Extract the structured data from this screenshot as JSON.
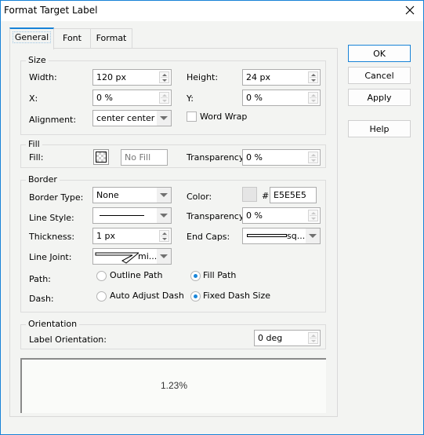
{
  "window": {
    "title": "Format Target Label"
  },
  "tabs": [
    {
      "label": "General",
      "active": true
    },
    {
      "label": "Font",
      "active": false
    },
    {
      "label": "Format",
      "active": false
    }
  ],
  "buttons": {
    "ok": "OK",
    "cancel": "Cancel",
    "apply": "Apply",
    "help": "Help"
  },
  "size": {
    "title": "Size",
    "width_label": "Width:",
    "width_value": "120 px",
    "height_label": "Height:",
    "height_value": "24 px",
    "x_label": "X:",
    "x_value": "0 %",
    "y_label": "Y:",
    "y_value": "0 %",
    "alignment_label": "Alignment:",
    "alignment_value": "center center",
    "word_wrap_label": "Word Wrap",
    "word_wrap_checked": false
  },
  "fill": {
    "title": "Fill",
    "fill_label": "Fill:",
    "fill_value": "No Fill",
    "transparency_label": "Transparency:",
    "transparency_value": "0 %"
  },
  "border": {
    "title": "Border",
    "border_type_label": "Border Type:",
    "border_type_value": "None",
    "color_label": "Color:",
    "color_hash": "#",
    "color_value": "E5E5E5",
    "color_hex": "#E5E5E5",
    "line_style_label": "Line Style:",
    "transparency_label": "Transparency:",
    "transparency_value": "0 %",
    "thickness_label": "Thickness:",
    "thickness_value": "1 px",
    "end_caps_label": "End Caps:",
    "end_caps_value": "sq...",
    "line_joint_label": "Line Joint:",
    "line_joint_value": "mi...",
    "path_label": "Path:",
    "path_options": [
      "Outline Path",
      "Fill Path"
    ],
    "path_selected": "Fill Path",
    "dash_label": "Dash:",
    "dash_options": [
      "Auto Adjust Dash",
      "Fixed Dash Size"
    ],
    "dash_selected": "Fixed Dash Size"
  },
  "orientation": {
    "title": "Orientation",
    "label_orientation_label": "Label Orientation:",
    "label_orientation_value": "0 deg"
  },
  "preview": {
    "text": "1.23%"
  }
}
